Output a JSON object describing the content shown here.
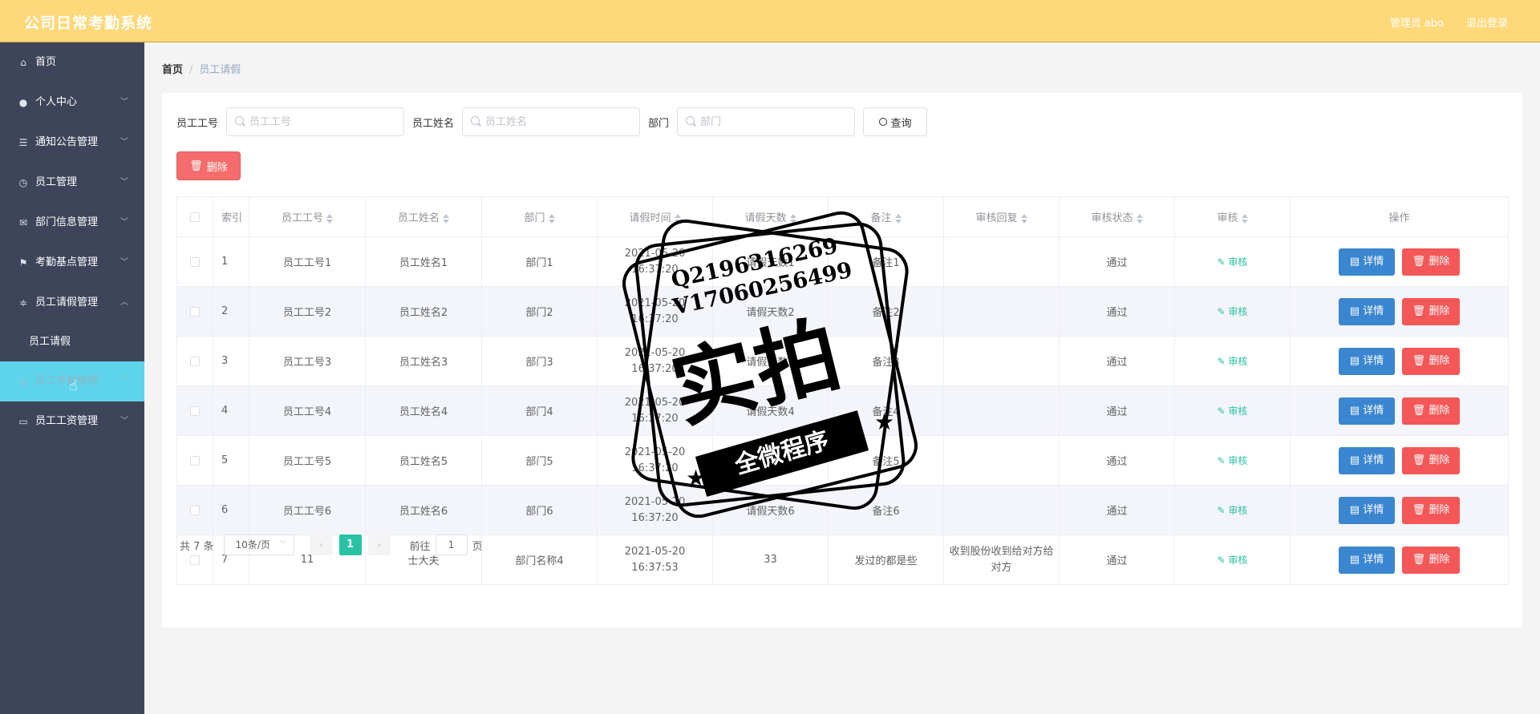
{
  "header": {
    "title": "公司日常考勤系统",
    "user": "管理员 abo",
    "logout": "退出登录"
  },
  "sidebar": {
    "items": [
      {
        "label": "首页",
        "icon": "home-icon"
      },
      {
        "label": "个人中心",
        "icon": "user-icon"
      },
      {
        "label": "通知公告管理",
        "icon": "list-icon"
      },
      {
        "label": "员工管理",
        "icon": "clock-icon"
      },
      {
        "label": "部门信息管理",
        "icon": "mail-icon"
      },
      {
        "label": "考勤基点管理",
        "icon": "flag-icon"
      },
      {
        "label": "员工请假管理",
        "icon": "sliders-icon"
      },
      {
        "label": "员工请假",
        "icon": ""
      },
      {
        "label": "员工考勤管理",
        "icon": "target-icon"
      },
      {
        "label": "员工工资管理",
        "icon": "card-icon"
      }
    ]
  },
  "breadcrumb": {
    "home": "首页",
    "separator": "/",
    "current": "员工请假"
  },
  "search": {
    "emp_no_label": "员工工号",
    "emp_no_placeholder": "员工工号",
    "emp_name_label": "员工姓名",
    "emp_name_placeholder": "员工姓名",
    "dept_label": "部门",
    "dept_placeholder": "部门",
    "query_button": "查询"
  },
  "toolbar": {
    "delete_button": "删除"
  },
  "table": {
    "headers": [
      "索引",
      "员工工号",
      "员工姓名",
      "部门",
      "请假时间",
      "请假天数",
      "备注",
      "审核回复",
      "审核状态",
      "审核",
      "操作"
    ],
    "rows": [
      {
        "index": "1",
        "emp_no": "员工工号1",
        "emp_name": "员工姓名1",
        "dept": "部门1",
        "time": "2021-05-20 16:37:20",
        "days": "请假天数1",
        "remark": "备注1",
        "reply": "",
        "status": "通过",
        "audit": "审核",
        "detail": "详情",
        "delete": "删除"
      },
      {
        "index": "2",
        "emp_no": "员工工号2",
        "emp_name": "员工姓名2",
        "dept": "部门2",
        "time": "2021-05-20 16:37:20",
        "days": "请假天数2",
        "remark": "备注2",
        "reply": "",
        "status": "通过",
        "audit": "审核",
        "detail": "详情",
        "delete": "删除"
      },
      {
        "index": "3",
        "emp_no": "员工工号3",
        "emp_name": "员工姓名3",
        "dept": "部门3",
        "time": "2021-05-20 16:37:20",
        "days": "请假天数3",
        "remark": "备注3",
        "reply": "",
        "status": "通过",
        "audit": "审核",
        "detail": "详情",
        "delete": "删除"
      },
      {
        "index": "4",
        "emp_no": "员工工号4",
        "emp_name": "员工姓名4",
        "dept": "部门4",
        "time": "2021-05-20 16:37:20",
        "days": "请假天数4",
        "remark": "备注4",
        "reply": "",
        "status": "通过",
        "audit": "审核",
        "detail": "详情",
        "delete": "删除"
      },
      {
        "index": "5",
        "emp_no": "员工工号5",
        "emp_name": "员工姓名5",
        "dept": "部门5",
        "time": "2021-05-20 16:37:20",
        "days": "请假天数5",
        "remark": "备注5",
        "reply": "",
        "status": "通过",
        "audit": "审核",
        "detail": "详情",
        "delete": "删除"
      },
      {
        "index": "6",
        "emp_no": "员工工号6",
        "emp_name": "员工姓名6",
        "dept": "部门6",
        "time": "2021-05-20 16:37:20",
        "days": "请假天数6",
        "remark": "备注6",
        "reply": "",
        "status": "通过",
        "audit": "审核",
        "detail": "详情",
        "delete": "删除"
      },
      {
        "index": "7",
        "emp_no": "11",
        "emp_name": "士大夫",
        "dept": "部门名称4",
        "time": "2021-05-20 16:37:53",
        "days": "33",
        "remark": "发过的都是些",
        "reply": "收到股份收到给对方给对方",
        "status": "通过",
        "audit": "审核",
        "detail": "详情",
        "delete": "删除"
      }
    ]
  },
  "pagination": {
    "total": "共 7 条",
    "page_size": "10条/页",
    "current_page": "1",
    "goto_prefix": "前往",
    "goto_value": "1",
    "goto_suffix": "页"
  },
  "watermark": {
    "line1": "Q2196316269",
    "line2": "V17060256499",
    "big": "实拍",
    "ribbon": "全微程序"
  },
  "colors": {
    "header_bg": "#ffd879",
    "sidebar_bg": "#3e4459",
    "sidebar_active": "#5ed3ec",
    "primary_teal": "#29c2a4",
    "detail_blue": "#3a86d0",
    "danger_red": "#f35757"
  }
}
